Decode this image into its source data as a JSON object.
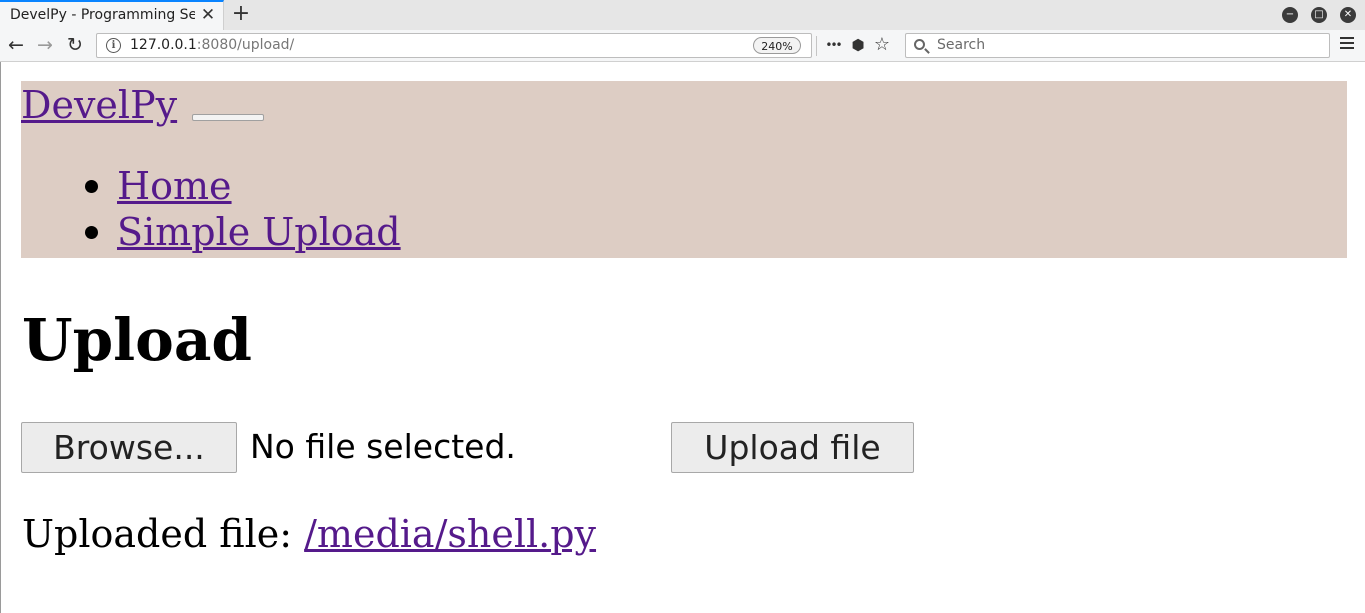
{
  "browser": {
    "tab_title": "DevelPy - Programming Ser",
    "close_glyph": "✕",
    "newtab_glyph": "+",
    "back_glyph": "←",
    "forward_glyph": "→",
    "reload_glyph": "↻",
    "url_host": "127.0.0.1",
    "url_rest": ":8080/upload/",
    "zoom": "240%",
    "more_glyph": "•••",
    "pocket_glyph": "⬢",
    "bookmark_glyph": "☆",
    "search_placeholder": "Search",
    "minimize_glyph": "−",
    "maximize_glyph": "□",
    "window_close_glyph": "✕"
  },
  "page": {
    "brand": "DevelPy",
    "nav": [
      "Home",
      "Simple Upload"
    ],
    "title": "Upload",
    "browse_label": "Browse...",
    "no_file_text": "No file selected.",
    "upload_label": "Upload file",
    "uploaded_label": "Uploaded file: ",
    "uploaded_link": "/media/shell.py"
  },
  "colors": {
    "header_bg": "#ddcdc4",
    "link": "#551a8b",
    "tab_accent": "#0a84ff"
  }
}
